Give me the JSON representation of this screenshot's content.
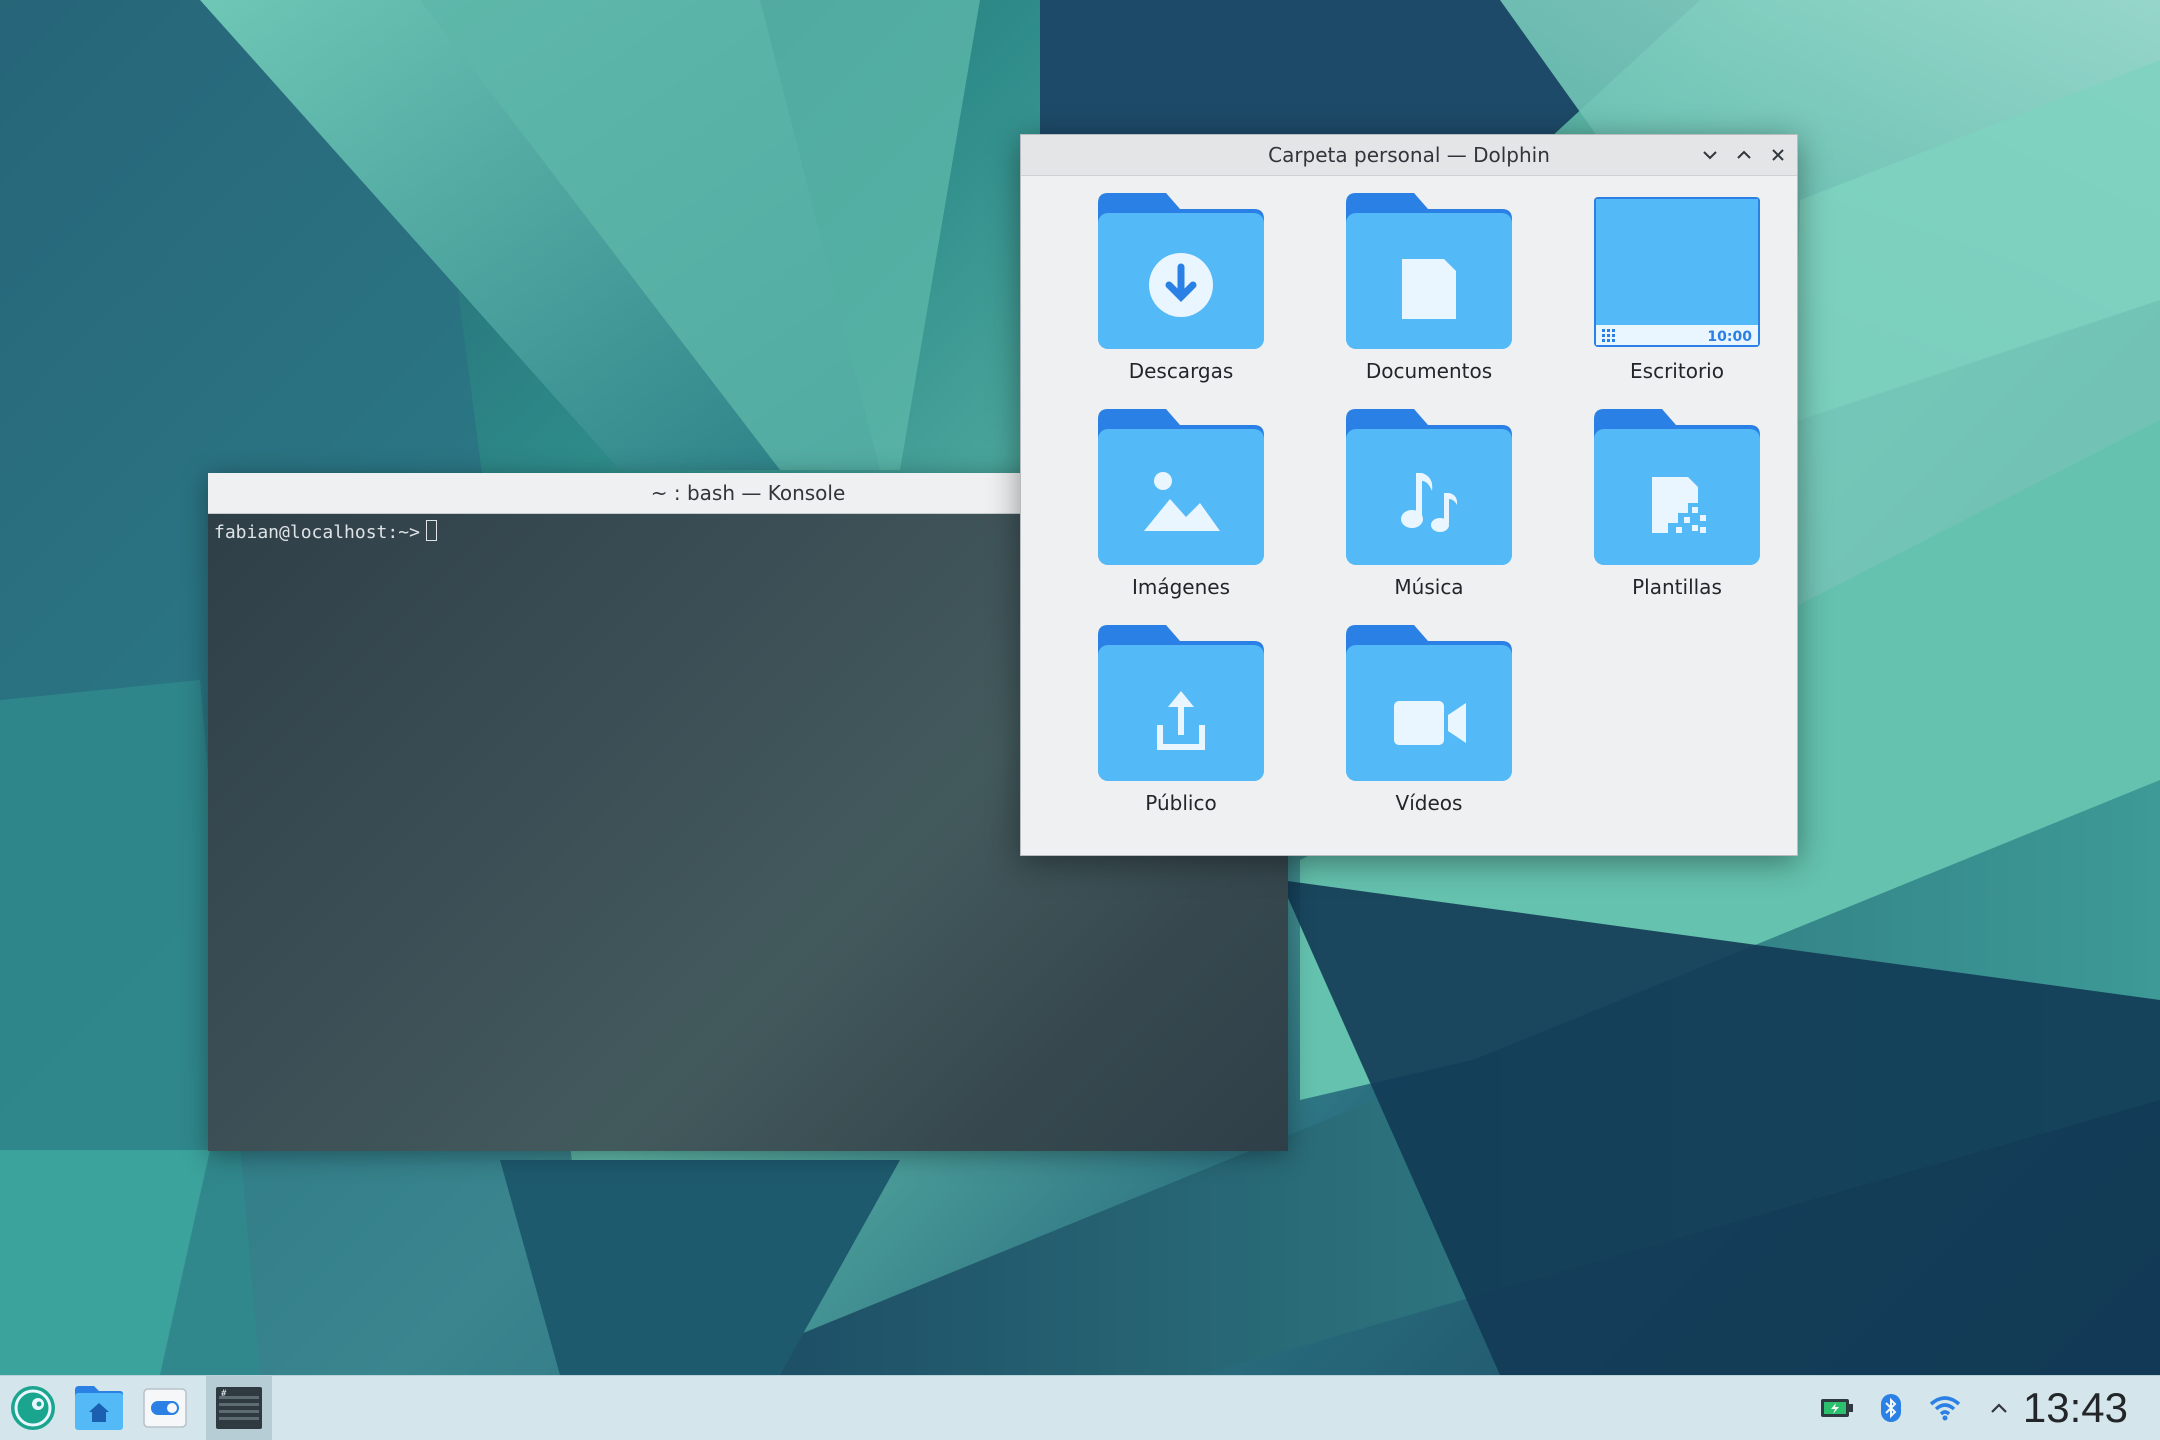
{
  "konsole": {
    "title": "~ : bash — Konsole",
    "prompt": "fabian@localhost:~>"
  },
  "dolphin": {
    "title": "Carpeta personal — Dolphin",
    "items": [
      {
        "label": "Descargas",
        "icon": "download-folder-icon"
      },
      {
        "label": "Documentos",
        "icon": "documents-folder-icon"
      },
      {
        "label": "Escritorio",
        "icon": "desktop-folder-icon",
        "clock": "10:00"
      },
      {
        "label": "Imágenes",
        "icon": "pictures-folder-icon"
      },
      {
        "label": "Música",
        "icon": "music-folder-icon"
      },
      {
        "label": "Plantillas",
        "icon": "templates-folder-icon"
      },
      {
        "label": "Público",
        "icon": "public-folder-icon"
      },
      {
        "label": "Vídeos",
        "icon": "videos-folder-icon"
      }
    ]
  },
  "taskbar": {
    "clock": "13:43"
  },
  "colors": {
    "folder_back": "#2a80e4",
    "folder_front": "#54b9f7",
    "folder_glyph": "#eaf6ff",
    "taskbar_bg": "#d4e6ec"
  }
}
